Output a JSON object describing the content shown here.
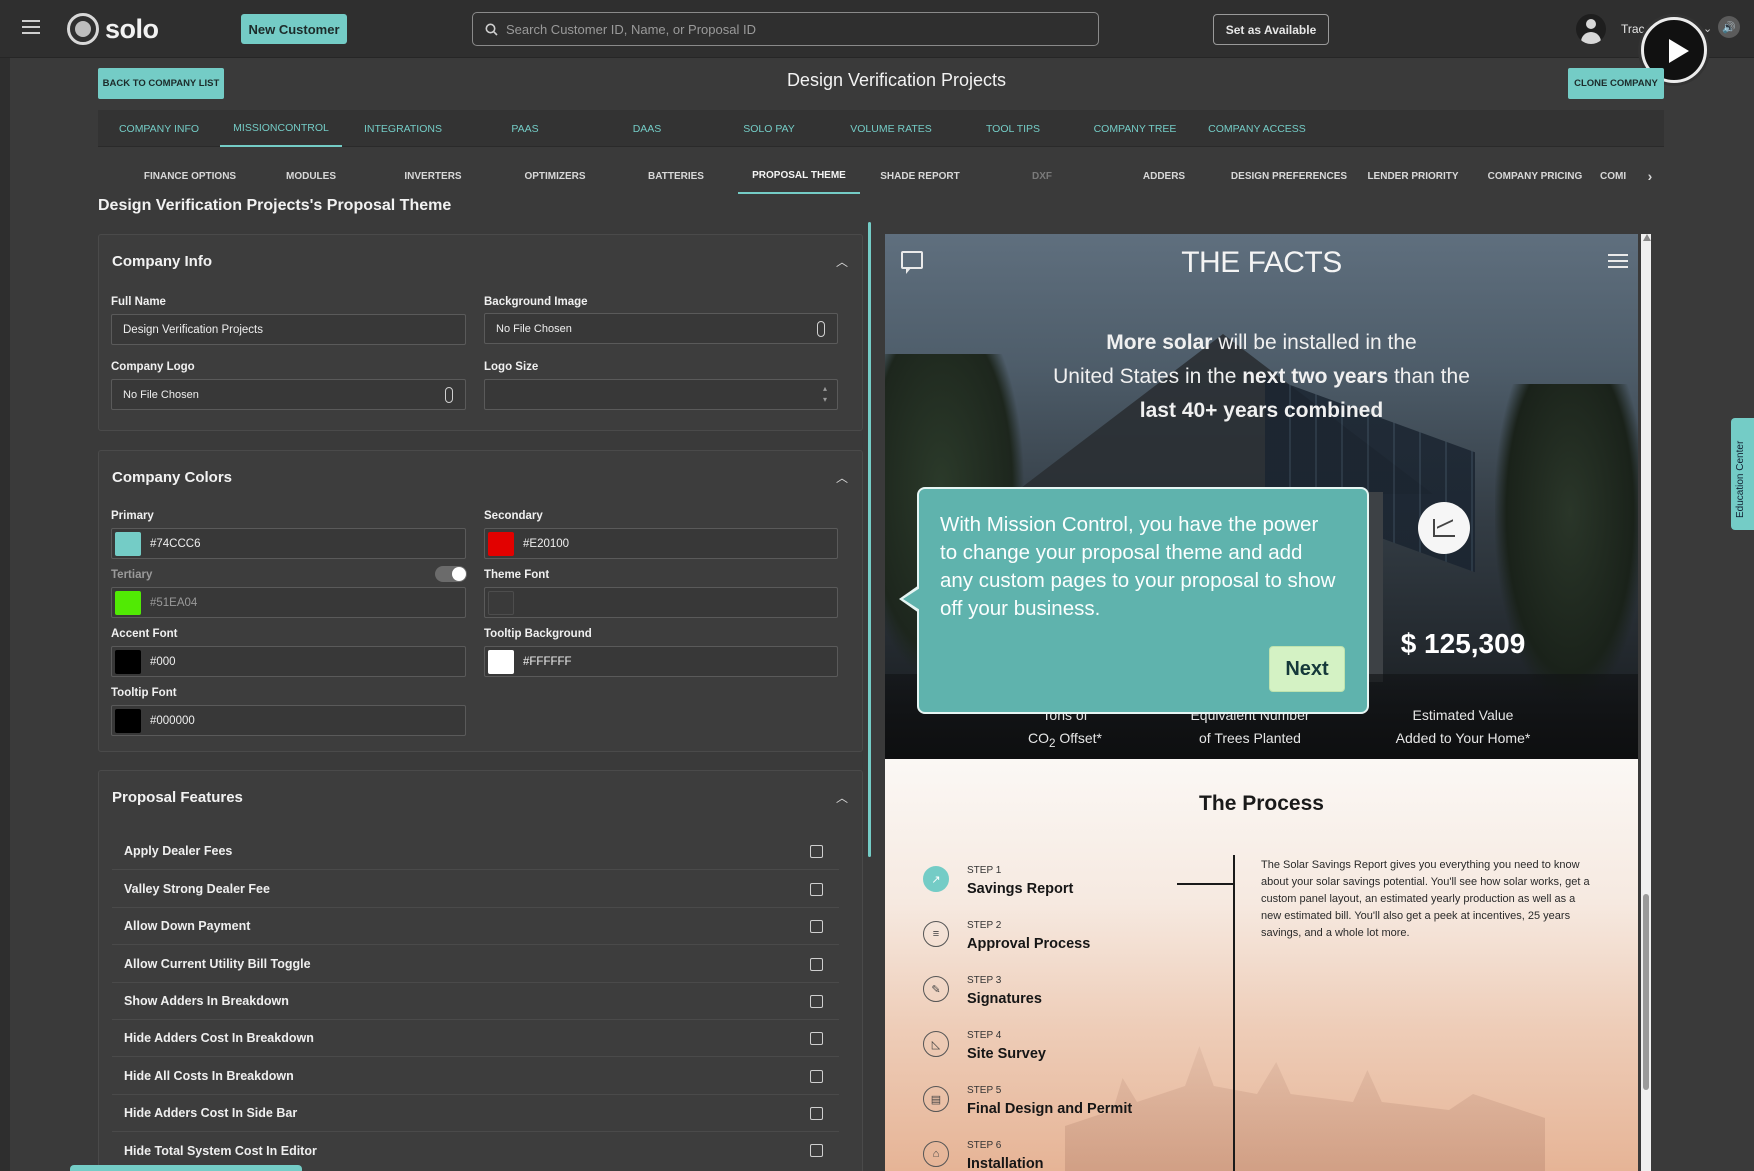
{
  "topbar": {
    "logo_text": "solo",
    "new_customer": "New Customer",
    "search_placeholder": "Search Customer ID, Name, or Proposal ID",
    "set_available": "Set as Available",
    "username": "Trac"
  },
  "header": {
    "back_button": "BACK TO COMPANY LIST",
    "title": "Design Verification Projects",
    "clone_button": "CLONE COMPANY"
  },
  "tabs_primary": [
    {
      "label": "COMPANY INFO",
      "active": false
    },
    {
      "label": "MISSIONCONTROL",
      "active": true
    },
    {
      "label": "INTEGRATIONS",
      "active": false
    },
    {
      "label": "PAAS",
      "active": false
    },
    {
      "label": "DAAS",
      "active": false
    },
    {
      "label": "SOLO PAY",
      "active": false
    },
    {
      "label": "VOLUME RATES",
      "active": false
    },
    {
      "label": "TOOL TIPS",
      "active": false
    },
    {
      "label": "COMPANY TREE",
      "active": false
    },
    {
      "label": "COMPANY ACCESS",
      "active": false
    }
  ],
  "tabs_secondary": [
    {
      "label": "FINANCE OPTIONS"
    },
    {
      "label": "MODULES"
    },
    {
      "label": "INVERTERS"
    },
    {
      "label": "OPTIMIZERS"
    },
    {
      "label": "BATTERIES"
    },
    {
      "label": "PROPOSAL THEME",
      "active": true
    },
    {
      "label": "SHADE REPORT"
    },
    {
      "label": "DXF",
      "muted": true
    },
    {
      "label": "ADDERS"
    },
    {
      "label": "DESIGN PREFERENCES"
    },
    {
      "label": "LENDER PRIORITY"
    },
    {
      "label": "COMPANY PRICING"
    },
    {
      "label": "COMI"
    }
  ],
  "section_heading": "Design Verification Projects's Proposal Theme",
  "company_info": {
    "title": "Company Info",
    "full_name_label": "Full Name",
    "full_name_value": "Design Verification Projects",
    "background_image_label": "Background Image",
    "background_image_value": "No File Chosen",
    "company_logo_label": "Company Logo",
    "company_logo_value": "No File Chosen",
    "logo_size_label": "Logo Size",
    "logo_size_value": ""
  },
  "company_colors": {
    "title": "Company Colors",
    "primary_label": "Primary",
    "primary_value": "#74CCC6",
    "secondary_label": "Secondary",
    "secondary_value": "#E20100",
    "tertiary_label": "Tertiary",
    "tertiary_value": "#51EA04",
    "theme_font_label": "Theme Font",
    "theme_font_value": "",
    "accent_font_label": "Accent Font",
    "accent_font_value": "#000",
    "tooltip_background_label": "Tooltip Background",
    "tooltip_background_value": "#FFFFFF",
    "tooltip_font_label": "Tooltip Font",
    "tooltip_font_value": "#000000",
    "swatches": {
      "primary": "#74CCC6",
      "secondary": "#E20100",
      "tertiary": "#51EA04",
      "accent_font": "#000000",
      "tooltip_background": "#FFFFFF",
      "tooltip_font": "#000000"
    }
  },
  "proposal_features": {
    "title": "Proposal Features",
    "items": [
      {
        "label": "Apply Dealer Fees",
        "checked": false
      },
      {
        "label": "Valley Strong Dealer Fee",
        "checked": false
      },
      {
        "label": "Allow Down Payment",
        "checked": false
      },
      {
        "label": "Allow Current Utility Bill Toggle",
        "checked": false
      },
      {
        "label": "Show Adders In Breakdown",
        "checked": false
      },
      {
        "label": "Hide Adders Cost In Breakdown",
        "checked": false
      },
      {
        "label": "Hide All Costs In Breakdown",
        "checked": false
      },
      {
        "label": "Hide Adders Cost In Side Bar",
        "checked": false
      },
      {
        "label": "Hide Total System Cost In Editor",
        "checked": false
      }
    ]
  },
  "preview": {
    "facts_title": "THE FACTS",
    "facts_line1_bold": "More solar",
    "facts_line1_rest": " will be installed in the",
    "facts_line2_a": "United States in the ",
    "facts_line2_bold": "next two years",
    "facts_line2_b": " than the",
    "facts_line3_bold": "last 40+ years combined",
    "stat_value": "$ 125,309",
    "stat1_label_a": "Tons of",
    "stat1_label_b": "CO",
    "stat1_label_sub": "2",
    "stat1_label_c": " Offset*",
    "stat2_label_a": "Equivalent Number",
    "stat2_label_b": "of Trees Planted",
    "stat3_label_a": "Estimated Value",
    "stat3_label_b": "Added to Your Home*",
    "tooltip_text": "With Mission Control, you have the power to change your proposal theme and add any custom pages to your proposal to show off your business.",
    "tooltip_next": "Next",
    "process_title": "The Process",
    "process_desc": "The Solar Savings Report gives you everything you need to know about your solar savings potential. You'll see how solar works, get a custom panel layout, an estimated yearly production as well as a new estimated bill. You'll also get a peek at incentives, 25 years savings, and a whole lot more.",
    "steps": [
      {
        "num": "STEP 1",
        "name": "Savings Report"
      },
      {
        "num": "STEP 2",
        "name": "Approval Process"
      },
      {
        "num": "STEP 3",
        "name": "Signatures"
      },
      {
        "num": "STEP 4",
        "name": "Site Survey"
      },
      {
        "num": "STEP 5",
        "name": "Final Design and Permit"
      },
      {
        "num": "STEP 6",
        "name": "Installation"
      }
    ]
  },
  "education_center": "Education Center"
}
